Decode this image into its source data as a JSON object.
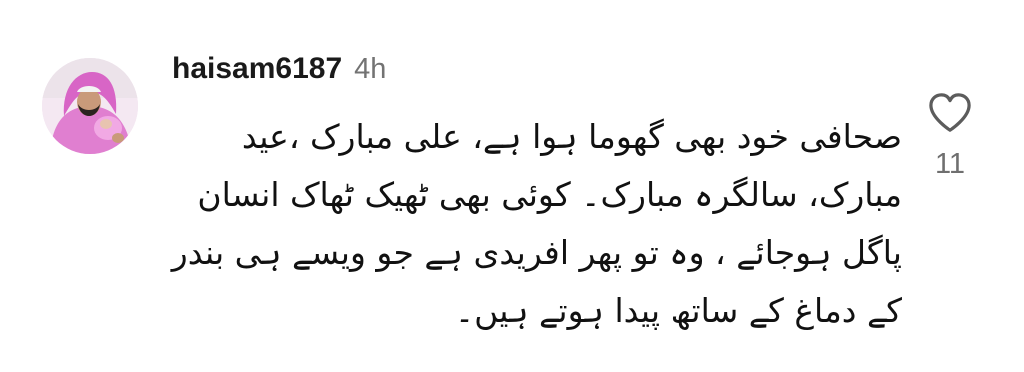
{
  "comment": {
    "username": "haisam6187",
    "timestamp": "4h",
    "lines": [
      "صحافی خود بھی گھوما ہوا ہے، علی مبارک ،عید",
      "مبارک، سالگرہ مبارک۔ کوئی بھی ٹھیک ٹھاک انسان",
      "پاگل ہوجائے ، وہ تو پھر افریدی ہے جو ویسے ہی بندر",
      "کے دماغ کے ساتھ پیدا ہوتے ہیں۔"
    ],
    "like_count": "11",
    "like_icon": "heart-outline-icon",
    "avatar_icon": "user-avatar"
  },
  "colors": {
    "text": "#111111",
    "muted": "#737373",
    "avatar_accent": "#e07fd0"
  }
}
